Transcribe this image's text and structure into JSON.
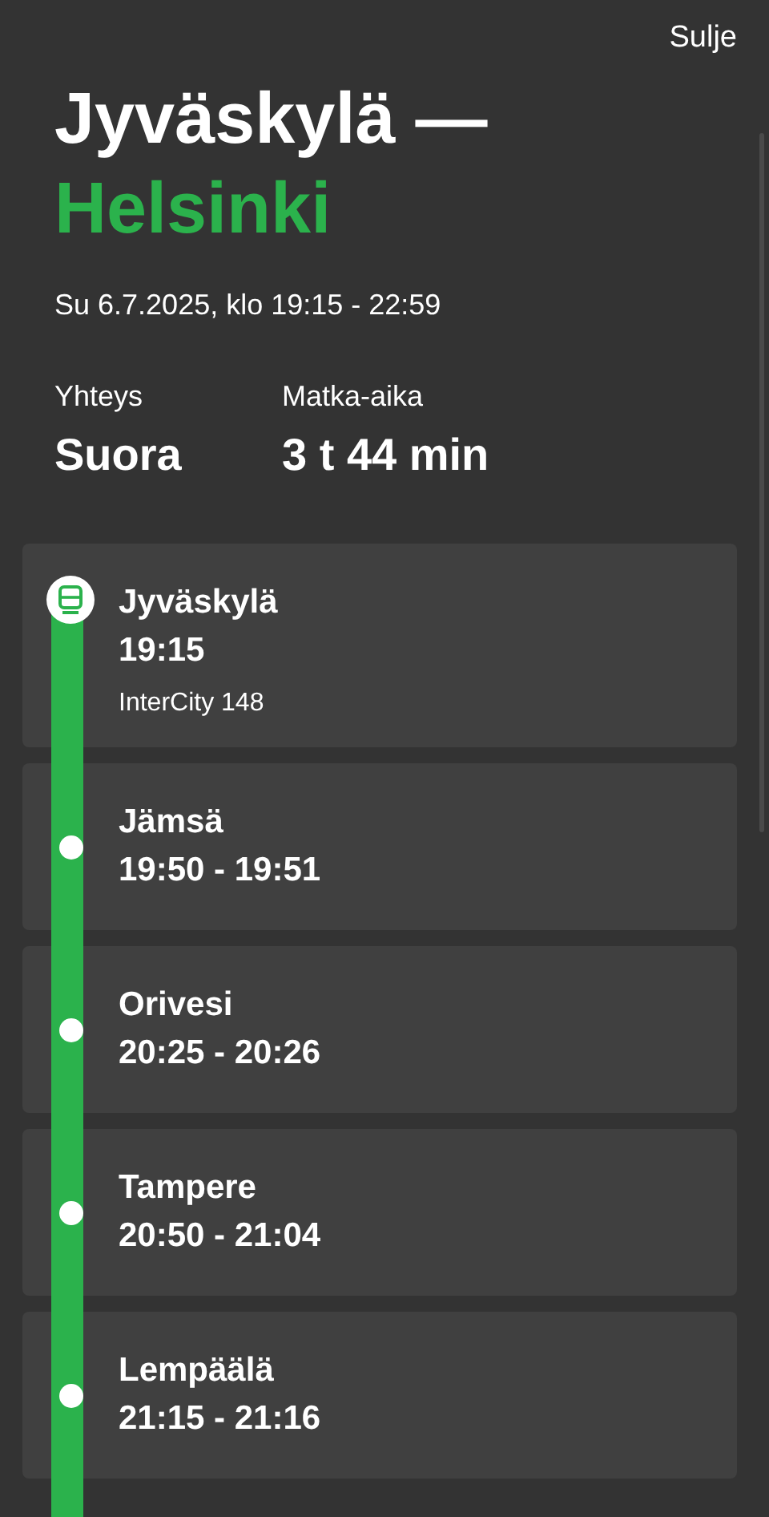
{
  "close_link": "Sulje",
  "title": {
    "from": "Jyväskylä —",
    "to": "Helsinki"
  },
  "date_time": "Su 6.7.2025, klo 19:15 - 22:59",
  "summary": [
    {
      "label": "Yhteys",
      "value": "Suora"
    },
    {
      "label": "Matka-aika",
      "value": "3 t 44 min"
    }
  ],
  "stops": [
    {
      "kind": "origin",
      "name": "Jyväskylä",
      "time": "19:15",
      "train": "InterCity 148"
    },
    {
      "kind": "stop",
      "name": "Jämsä",
      "time": "19:50 - 19:51"
    },
    {
      "kind": "stop",
      "name": "Orivesi",
      "time": "20:25 - 20:26"
    },
    {
      "kind": "stop",
      "name": "Tampere",
      "time": "20:50 - 21:04"
    },
    {
      "kind": "stop",
      "name": "Lempäälä",
      "time": "21:15 - 21:16"
    }
  ]
}
